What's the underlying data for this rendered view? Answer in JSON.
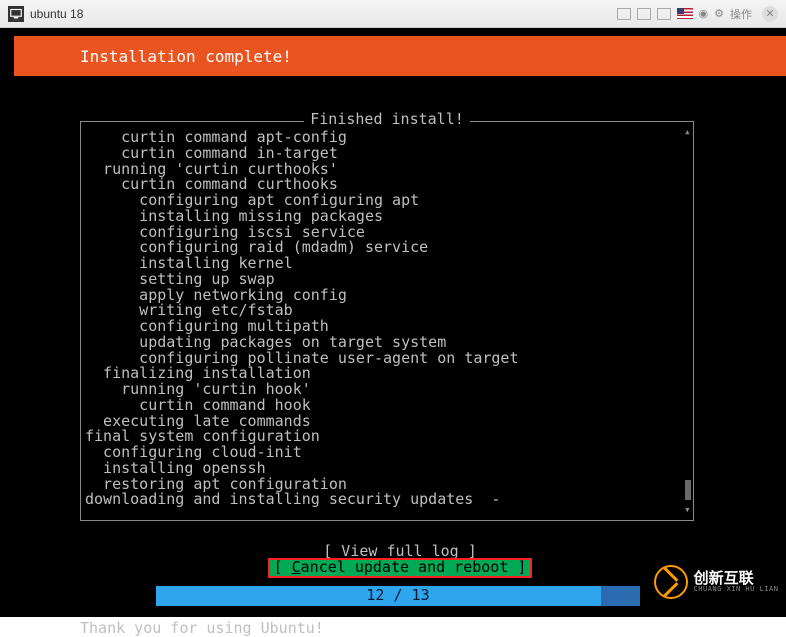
{
  "titlebar": {
    "vm_name": "ubuntu 18",
    "action_label": "操作"
  },
  "header": {
    "title": "Installation complete!"
  },
  "box": {
    "title": "Finished install!",
    "log_text": "    curtin command apt-config\n    curtin command in-target\n  running 'curtin curthooks'\n    curtin command curthooks\n      configuring apt configuring apt\n      installing missing packages\n      configuring iscsi service\n      configuring raid (mdadm) service\n      installing kernel\n      setting up swap\n      apply networking config\n      writing etc/fstab\n      configuring multipath\n      updating packages on target system\n      configuring pollinate user-agent on target\n  finalizing installation\n    running 'curtin hook'\n      curtin command hook\n  executing late commands\nfinal system configuration\n  configuring cloud-init\n  installing openssh\n  restoring apt configuration\ndownloading and installing security updates  -"
  },
  "buttons": {
    "view_log": "[ View full log             ]",
    "cancel_prefix": "[ ",
    "cancel_ul": "C",
    "cancel_rest": "ancel update and reboot ]"
  },
  "progress": {
    "label": "12 / 13"
  },
  "footer": {
    "text": "Thank you for using Ubuntu!"
  },
  "watermark": {
    "brand": "创新互联",
    "sub": "CHUANG XIN HU LIAN"
  }
}
